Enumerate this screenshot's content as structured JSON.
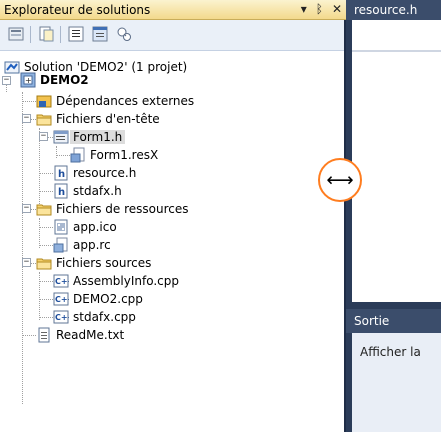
{
  "solution_explorer": {
    "title": "Explorateur de solutions",
    "title_buttons": [
      "▾",
      "ᛒ",
      "✕"
    ]
  },
  "tree": [
    {
      "label": "Solution 'DEMO2' (1 projet)",
      "icon": "solution-icon"
    },
    {
      "label": "DEMO2",
      "icon": "project-icon",
      "bold": true
    },
    {
      "label": "Dépendances externes",
      "icon": "dependencies-icon"
    },
    {
      "label": "Fichiers d'en-tête",
      "icon": "folder-icon"
    },
    {
      "label": "Form1.h",
      "icon": "form-icon",
      "selected": true
    },
    {
      "label": "Form1.resX",
      "icon": "resx-icon"
    },
    {
      "label": "resource.h",
      "icon": "header-file-icon"
    },
    {
      "label": "stdafx.h",
      "icon": "header-file-icon"
    },
    {
      "label": "Fichiers de ressources",
      "icon": "folder-icon"
    },
    {
      "label": "app.ico",
      "icon": "ico-file-icon"
    },
    {
      "label": "app.rc",
      "icon": "rc-file-icon"
    },
    {
      "label": "Fichiers sources",
      "icon": "folder-icon"
    },
    {
      "label": "AssemblyInfo.cpp",
      "icon": "cpp-file-icon"
    },
    {
      "label": "DEMO2.cpp",
      "icon": "cpp-file-icon"
    },
    {
      "label": "stdafx.cpp",
      "icon": "cpp-file-icon"
    },
    {
      "label": "ReadMe.txt",
      "icon": "text-file-icon"
    }
  ],
  "editor": {
    "tab": "resource.h"
  },
  "output": {
    "title": "Sortie",
    "show_output_from": "Afficher la"
  },
  "colors": {
    "accent": "#ff7d1f",
    "background": "#2b3c59",
    "title_bar": "#f3d98c"
  }
}
